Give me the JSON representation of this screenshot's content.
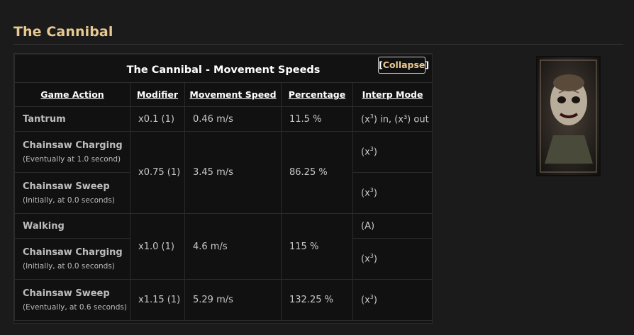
{
  "section": {
    "title": "The Cannibal"
  },
  "table": {
    "caption": "The Cannibal - Movement Speeds",
    "collapse_label": "Collapse",
    "headers": [
      "Game Action",
      "Modifier",
      "Movement Speed",
      "Percentage",
      "Interp Mode"
    ],
    "rows": [
      {
        "action": "Tantrum",
        "note": "",
        "modifier": "x0.1 (1)",
        "speed": "0.46 m/s",
        "percent": "11.5 %",
        "interp": "in, (x³) out"
      },
      {
        "action": "Chainsaw Charging",
        "note": "(Eventually at 1.0 second)",
        "modifier": "x0.75 (1)",
        "speed": "3.45 m/s",
        "percent": "86.25 %",
        "interp": "(x³)"
      },
      {
        "action": "Chainsaw Sweep",
        "note": "(Initially, at 0.0 seconds)",
        "interp": "(x³)"
      },
      {
        "action": "Walking",
        "note": "",
        "modifier": "x1.0 (1)",
        "speed": "4.6 m/s",
        "percent": "115 %",
        "interp": "(A)"
      },
      {
        "action": "Chainsaw Charging",
        "note": "(Initially, at 0.0 seconds)",
        "interp": "(x³)"
      },
      {
        "action": "Chainsaw Sweep",
        "note": "(Eventually, at 0.6 seconds)",
        "modifier": "x1.15 (1)",
        "speed": "5.29 m/s",
        "percent": "132.25 %",
        "interp": "(x³)"
      }
    ]
  },
  "portrait": {
    "icon": "cannibal-portrait-image"
  },
  "colors": {
    "heading": "#e8c992",
    "background": "#1b1b1b",
    "table_bg": "#111111"
  }
}
